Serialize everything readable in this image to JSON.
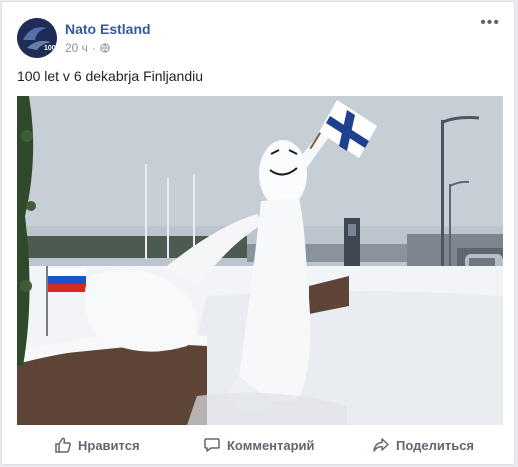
{
  "post": {
    "page_name": "Nato Estland",
    "time": "20 ч",
    "separator": "·",
    "text": "100 let v 6 dekabrja Finljandiu",
    "more_icon": "more-horizontal-icon",
    "privacy_icon": "globe-icon",
    "avatar_label": "100"
  },
  "actions": {
    "like_label": "Нравится",
    "comment_label": "Комментарий",
    "share_label": "Поделиться"
  },
  "colors": {
    "link": "#385898",
    "meta": "#90949c",
    "action": "#606770"
  }
}
